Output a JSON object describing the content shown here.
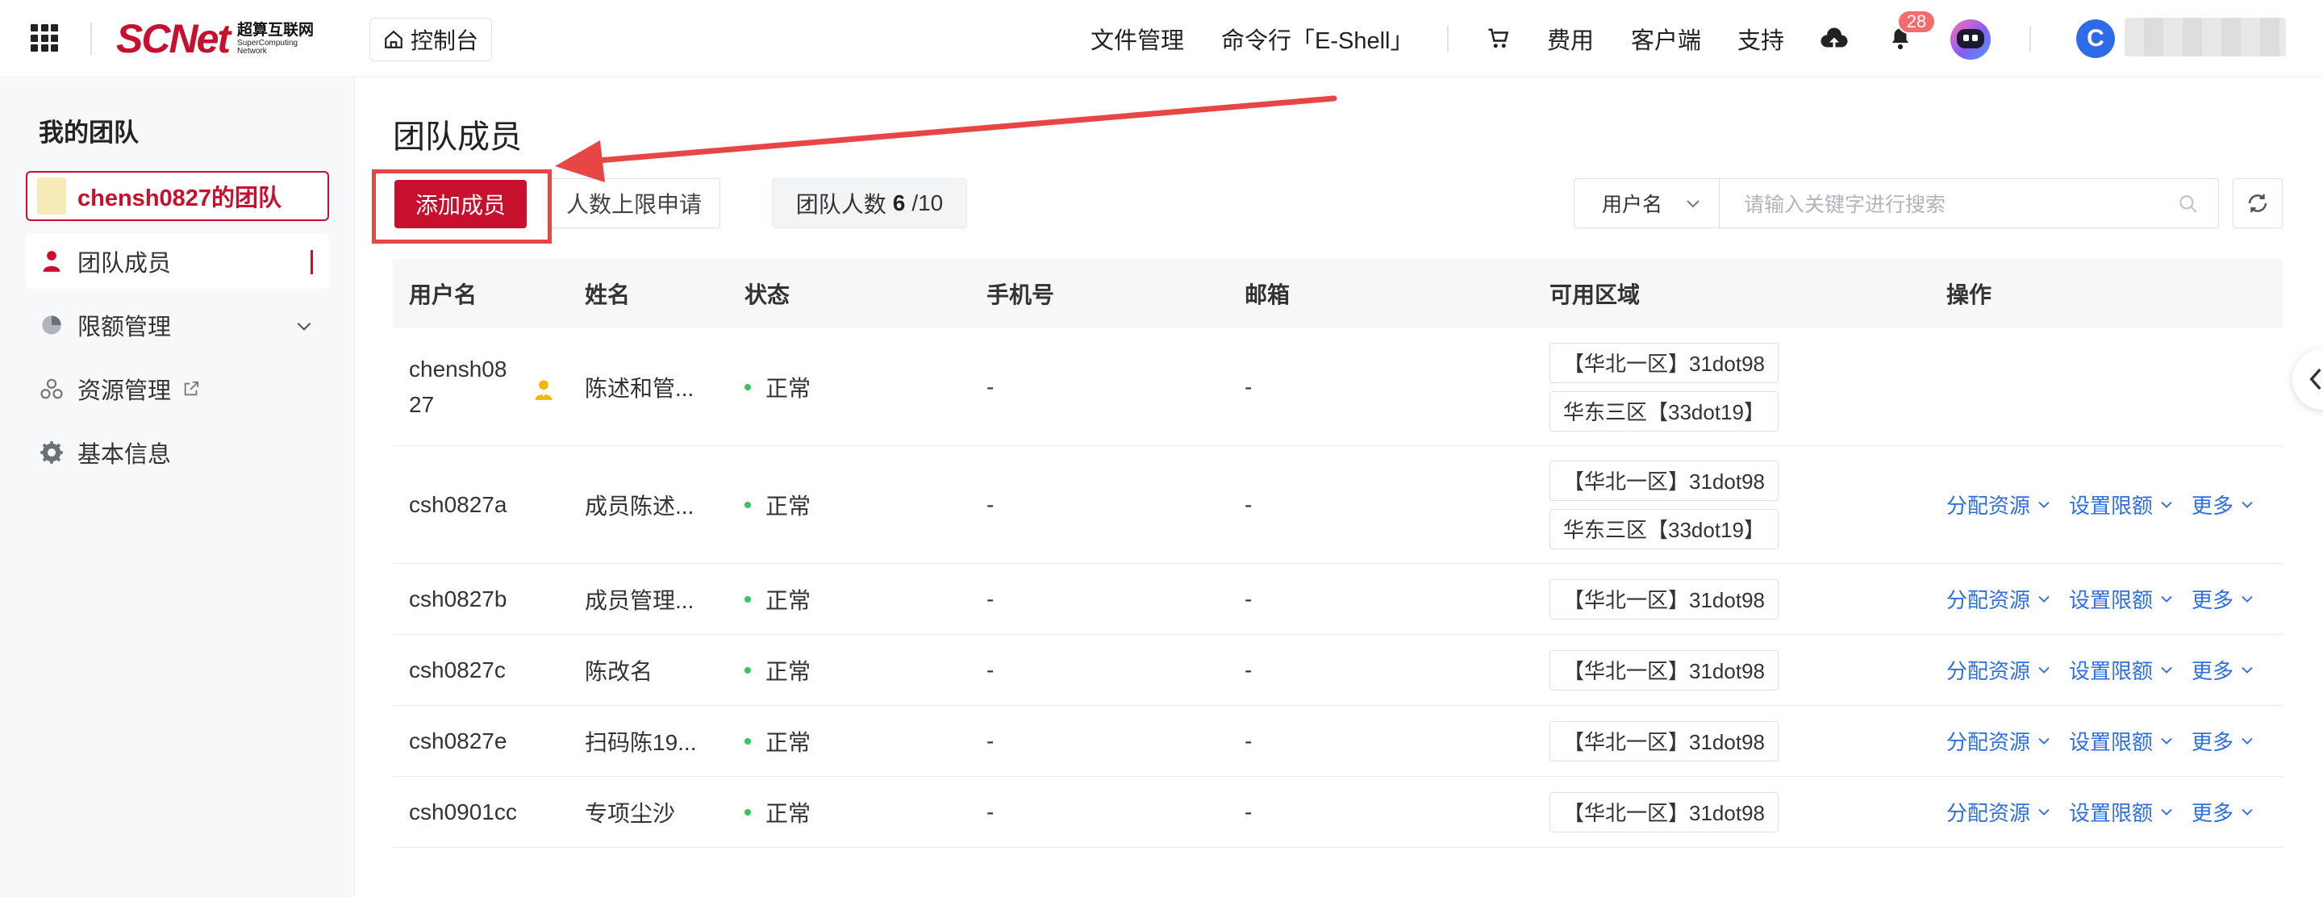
{
  "header": {
    "logo_text": "SCNet",
    "logo_cn": "超算互联网",
    "logo_en": "SuperComputing Network",
    "console_label": "控制台",
    "nav_files": "文件管理",
    "nav_shell": "命令行「E-Shell」",
    "nav_fees": "费用",
    "nav_client": "客户端",
    "nav_support": "支持",
    "notification_count": "28",
    "user_initial": "C"
  },
  "sidebar": {
    "title": "我的团队",
    "team_name": "chensh0827的团队",
    "items": [
      {
        "label": "团队成员"
      },
      {
        "label": "限额管理"
      },
      {
        "label": "资源管理"
      },
      {
        "label": "基本信息"
      }
    ]
  },
  "main": {
    "title": "团队成员",
    "add_member": "添加成员",
    "limit_request": "人数上限申请",
    "count_label": "团队人数",
    "count_current": "6",
    "count_max": "/10",
    "search_field": "用户名",
    "search_placeholder": "请输入关键字进行搜索"
  },
  "table": {
    "columns": [
      "用户名",
      "姓名",
      "状态",
      "手机号",
      "邮箱",
      "可用区域",
      "操作"
    ],
    "rows": [
      {
        "username_line1": "chensh08",
        "username_line2": "27",
        "name": "陈述和管...",
        "status": "正常",
        "phone": "-",
        "email": "-",
        "regions": [
          "【华北一区】31dot98",
          "华东三区【33dot19】"
        ],
        "owner": true
      },
      {
        "username": "csh0827a",
        "name": "成员陈述...",
        "status": "正常",
        "phone": "-",
        "email": "-",
        "regions": [
          "【华北一区】31dot98",
          "华东三区【33dot19】"
        ]
      },
      {
        "username": "csh0827b",
        "name": "成员管理...",
        "status": "正常",
        "phone": "-",
        "email": "-",
        "regions": [
          "【华北一区】31dot98"
        ]
      },
      {
        "username": "csh0827c",
        "name": "陈改名",
        "status": "正常",
        "phone": "-",
        "email": "-",
        "regions": [
          "【华北一区】31dot98"
        ]
      },
      {
        "username": "csh0827e",
        "name": "扫码陈19...",
        "status": "正常",
        "phone": "-",
        "email": "-",
        "regions": [
          "【华北一区】31dot98"
        ]
      },
      {
        "username": "csh0901cc",
        "name": "专项尘沙",
        "status": "正常",
        "phone": "-",
        "email": "-",
        "regions": [
          "【华北一区】31dot98"
        ]
      }
    ],
    "ops": [
      "分配资源",
      "设置限额",
      "更多"
    ]
  },
  "colors": {
    "brand": "#c8102e",
    "link": "#2f6fe4",
    "status_ok": "#34c759",
    "annotation": "#e84545"
  }
}
